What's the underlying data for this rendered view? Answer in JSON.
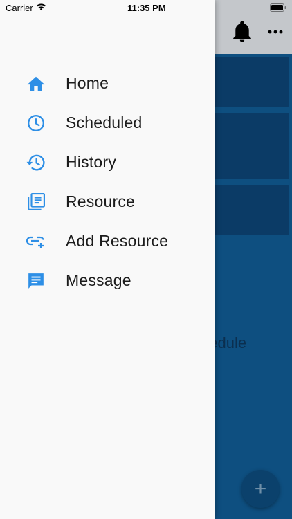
{
  "status_bar": {
    "carrier": "Carrier",
    "time": "11:35 PM"
  },
  "background_app": {
    "partial_text_1": "e",
    "partial_text_2": "hedule",
    "fab_symbol": "+"
  },
  "drawer": {
    "items": [
      {
        "label": "Home",
        "icon": "home-icon"
      },
      {
        "label": "Scheduled",
        "icon": "clock-icon"
      },
      {
        "label": "History",
        "icon": "history-icon"
      },
      {
        "label": "Resource",
        "icon": "library-books-icon"
      },
      {
        "label": "Add Resource",
        "icon": "add-link-icon"
      },
      {
        "label": "Message",
        "icon": "message-icon"
      }
    ]
  },
  "colors": {
    "accent": "#2e8fe6",
    "drawer_bg": "#f9f9f9",
    "app_bg": "#0e4f80"
  }
}
